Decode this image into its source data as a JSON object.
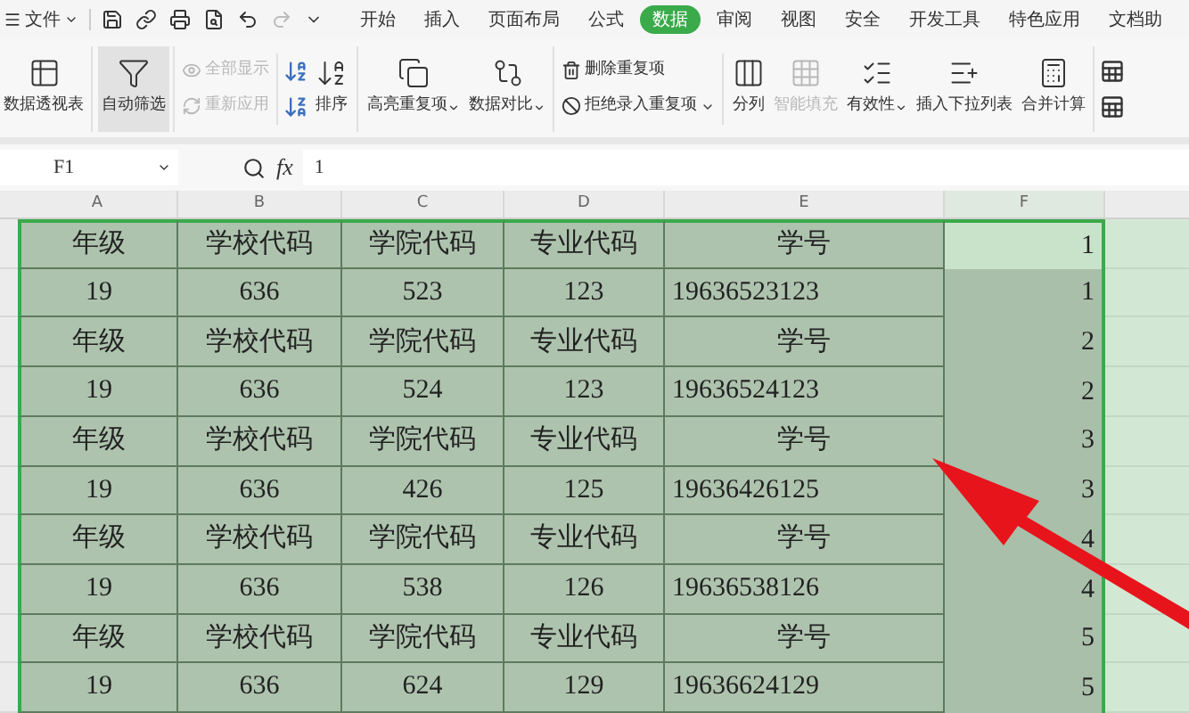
{
  "menu": {
    "file": "文件",
    "tabs": [
      {
        "label": "开始",
        "selected": false
      },
      {
        "label": "插入",
        "selected": false
      },
      {
        "label": "页面布局",
        "selected": false
      },
      {
        "label": "公式",
        "selected": false
      },
      {
        "label": "数据",
        "selected": true
      },
      {
        "label": "审阅",
        "selected": false
      },
      {
        "label": "视图",
        "selected": false
      },
      {
        "label": "安全",
        "selected": false
      },
      {
        "label": "开发工具",
        "selected": false
      },
      {
        "label": "特色应用",
        "selected": false
      },
      {
        "label": "文档助",
        "selected": false
      }
    ]
  },
  "ribbon": {
    "groups": [
      {
        "kind": "large",
        "items": [
          {
            "label": "数据透视表",
            "disabled": false,
            "pressed": false,
            "dropdown": false
          }
        ]
      },
      {
        "kind": "large",
        "items": [
          {
            "label": "自动筛选",
            "disabled": false,
            "pressed": true,
            "dropdown": false
          }
        ]
      },
      {
        "kind": "stack",
        "items": [
          {
            "label": "全部显示",
            "disabled": true,
            "pressed": false,
            "dropdown": false
          },
          {
            "label": "重新应用",
            "disabled": true,
            "pressed": false,
            "dropdown": false
          }
        ]
      },
      {
        "kind": "sort",
        "items": [
          {
            "label": "排序",
            "disabled": false,
            "pressed": false,
            "dropdown": false
          }
        ]
      },
      {
        "kind": "large",
        "items": [
          {
            "label": "高亮重复项",
            "disabled": false,
            "pressed": false,
            "dropdown": true
          },
          {
            "label": "数据对比",
            "disabled": false,
            "pressed": false,
            "dropdown": true
          }
        ]
      },
      {
        "kind": "stack",
        "items": [
          {
            "label": "删除重复项",
            "disabled": false,
            "pressed": false,
            "dropdown": false
          },
          {
            "label": "拒绝录入重复项",
            "disabled": false,
            "pressed": false,
            "dropdown": true
          }
        ]
      },
      {
        "kind": "large",
        "items": [
          {
            "label": "分列",
            "disabled": false,
            "pressed": false,
            "dropdown": false
          },
          {
            "label": "智能填充",
            "disabled": true,
            "pressed": false,
            "dropdown": false
          },
          {
            "label": "有效性",
            "disabled": false,
            "pressed": false,
            "dropdown": true
          },
          {
            "label": "插入下拉列表",
            "disabled": false,
            "pressed": false,
            "dropdown": false
          },
          {
            "label": "合并计算",
            "disabled": false,
            "pressed": false,
            "dropdown": false
          }
        ]
      }
    ]
  },
  "formula_bar": {
    "name_box": "F1",
    "fx": "fx",
    "value": "1"
  },
  "sheet": {
    "columns": [
      "A",
      "B",
      "C",
      "D",
      "E",
      "F"
    ],
    "rows": [
      {
        "cells": [
          "年级",
          "学校代码",
          "学院代码",
          "专业代码",
          "学号",
          "1"
        ],
        "active": true
      },
      {
        "cells": [
          "19",
          "636",
          "523",
          "123",
          "19636523123",
          "1"
        ],
        "active": false
      },
      {
        "cells": [
          "年级",
          "学校代码",
          "学院代码",
          "专业代码",
          "学号",
          "2"
        ],
        "active": false
      },
      {
        "cells": [
          "19",
          "636",
          "524",
          "123",
          "19636524123",
          "2"
        ],
        "active": false
      },
      {
        "cells": [
          "年级",
          "学校代码",
          "学院代码",
          "专业代码",
          "学号",
          "3"
        ],
        "active": false
      },
      {
        "cells": [
          "19",
          "636",
          "426",
          "125",
          "19636426125",
          "3"
        ],
        "active": false
      },
      {
        "cells": [
          "年级",
          "学校代码",
          "学院代码",
          "专业代码",
          "学号",
          "4"
        ],
        "active": false
      },
      {
        "cells": [
          "19",
          "636",
          "538",
          "126",
          "19636538126",
          "4"
        ],
        "active": false
      },
      {
        "cells": [
          "年级",
          "学校代码",
          "学院代码",
          "专业代码",
          "学号",
          "5"
        ],
        "active": false
      },
      {
        "cells": [
          "19",
          "636",
          "624",
          "129",
          "19636624129",
          "5"
        ],
        "active": false
      }
    ]
  }
}
